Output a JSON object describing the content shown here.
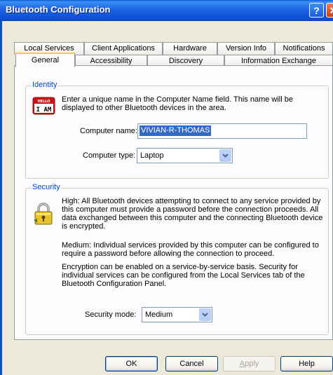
{
  "window": {
    "title": "Bluetooth Configuration"
  },
  "tabs_top": [
    "Local Services",
    "Client Applications",
    "Hardware",
    "Version Info",
    "Notifications"
  ],
  "tabs_bottom": [
    "General",
    "Accessibility",
    "Discovery",
    "Information Exchange"
  ],
  "identity": {
    "group_label": "Identity",
    "icon_badge_top": "HELLO",
    "icon_badge_text": "I AM",
    "description": "Enter a unique name in the Computer Name field. This name will be displayed to other Bluetooth devices in the area.",
    "computer_name_label": "Computer name:",
    "computer_name_value": "VIVIAN-R-THOMAS",
    "computer_type_label": "Computer type:",
    "computer_type_value": "Laptop"
  },
  "security": {
    "group_label": "Security",
    "high_text": "High: All Bluetooth devices attempting to connect to any service provided by this computer must provide a password before the connection proceeds. All data exchanged between this computer and the connecting Bluetooth device is encrypted.",
    "medium_text": "Medium: Individual services provided by this computer can be configured to require a password before allowing the connection to proceed.",
    "encryption_text": "Encryption can be enabled on a service-by-service basis. Security for individual services can be configured from the Local Services tab of the Bluetooth Configuration Panel.",
    "security_mode_label": "Security mode:",
    "security_mode_value": "Medium"
  },
  "buttons": {
    "ok": "OK",
    "cancel": "Cancel",
    "apply_first": "A",
    "apply_rest": "pply",
    "help": "Help"
  },
  "colors": {
    "title_bar": "#0d4fd4",
    "group_label": "#0046d5",
    "selection": "#316ac5",
    "active_tab_accent": "#ffc73c"
  }
}
